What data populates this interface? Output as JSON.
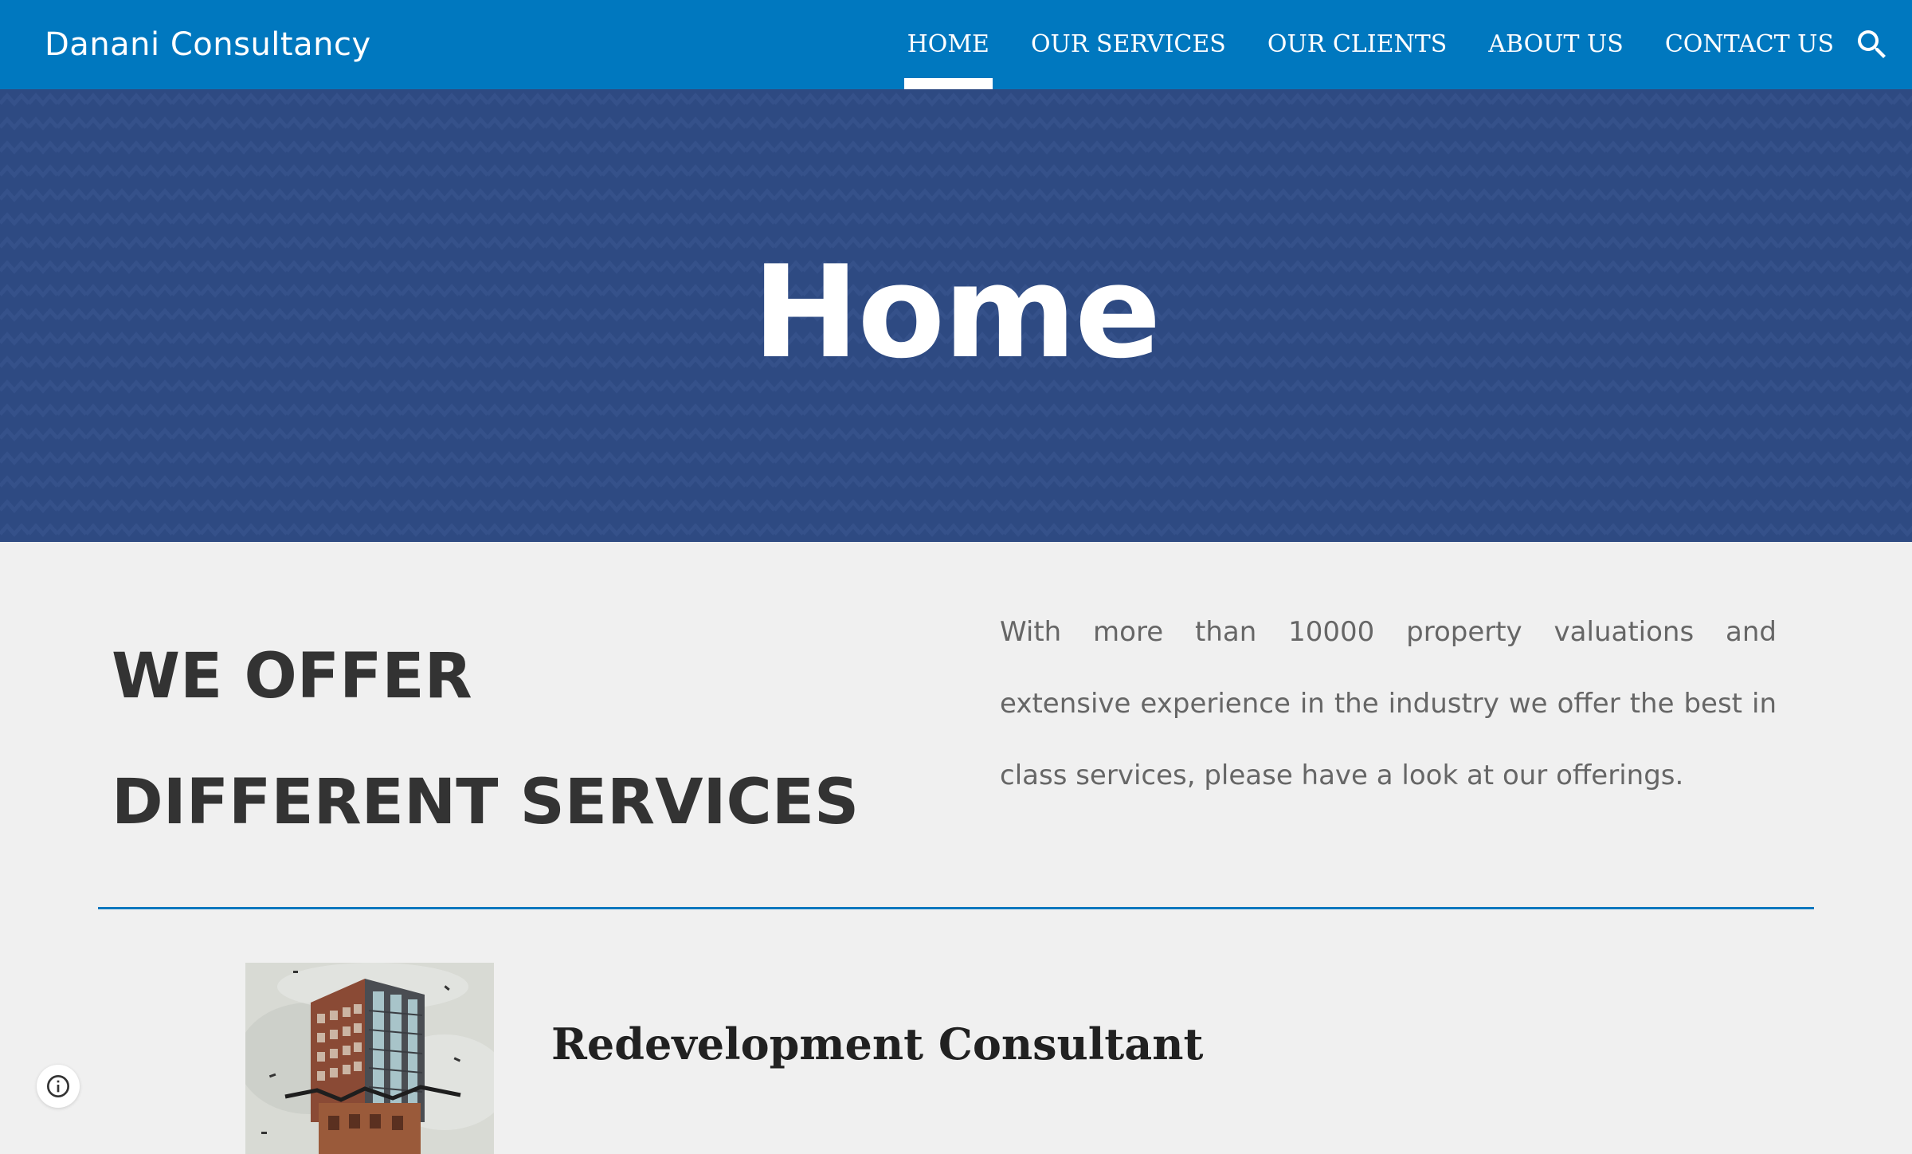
{
  "header": {
    "site_title": "Danani Consultancy",
    "nav": [
      {
        "label": "HOME",
        "active": true
      },
      {
        "label": "OUR SERVICES",
        "active": false
      },
      {
        "label": "OUR CLIENTS",
        "active": false
      },
      {
        "label": "ABOUT US",
        "active": false
      },
      {
        "label": "CONTACT US",
        "active": false
      }
    ],
    "search_icon": "search-icon"
  },
  "hero": {
    "title": "Home"
  },
  "offer": {
    "heading_line1": "WE OFFER",
    "heading_line2": "DIFFERENT SERVICES",
    "description": "With more than 10000 property valuations and extensive experience in the industry we offer the best in class services, please have a look at our offerings."
  },
  "services": [
    {
      "title": "Redevelopment Consultant",
      "image": "building-illustration"
    }
  ],
  "info_button": {
    "icon": "info-icon"
  },
  "colors": {
    "primary": "#0078bf",
    "hero_bg": "#2e4a82",
    "page_bg": "#f0f0f0",
    "heading_text": "#333333",
    "body_text": "#666666"
  }
}
